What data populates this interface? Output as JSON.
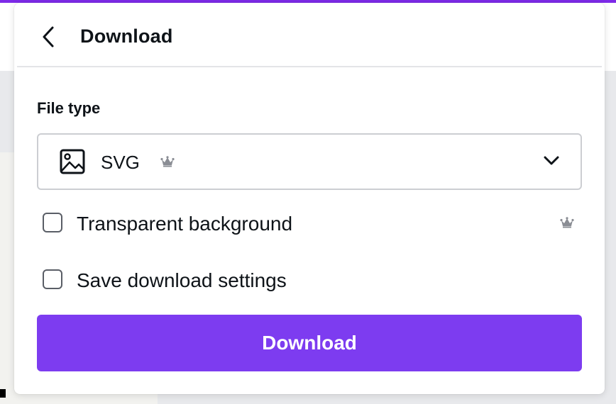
{
  "panel": {
    "title": "Download",
    "back_icon": "chevron-left-icon"
  },
  "file_type": {
    "label": "File type",
    "selected_value": "SVG",
    "value_icon": "image-icon",
    "premium_icon": "crown-icon",
    "dropdown_icon": "chevron-down-icon"
  },
  "options": {
    "transparent_background": {
      "label": "Transparent background",
      "checked": false,
      "premium_icon": "crown-icon"
    },
    "save_settings": {
      "label": "Save download settings",
      "checked": false
    }
  },
  "actions": {
    "download_label": "Download"
  },
  "colors": {
    "accent": "#7d3cf0",
    "brand_top_bar": "#7d2ae8",
    "text": "#0e1318",
    "border": "#ccced2",
    "crown": "#8a8d94"
  }
}
